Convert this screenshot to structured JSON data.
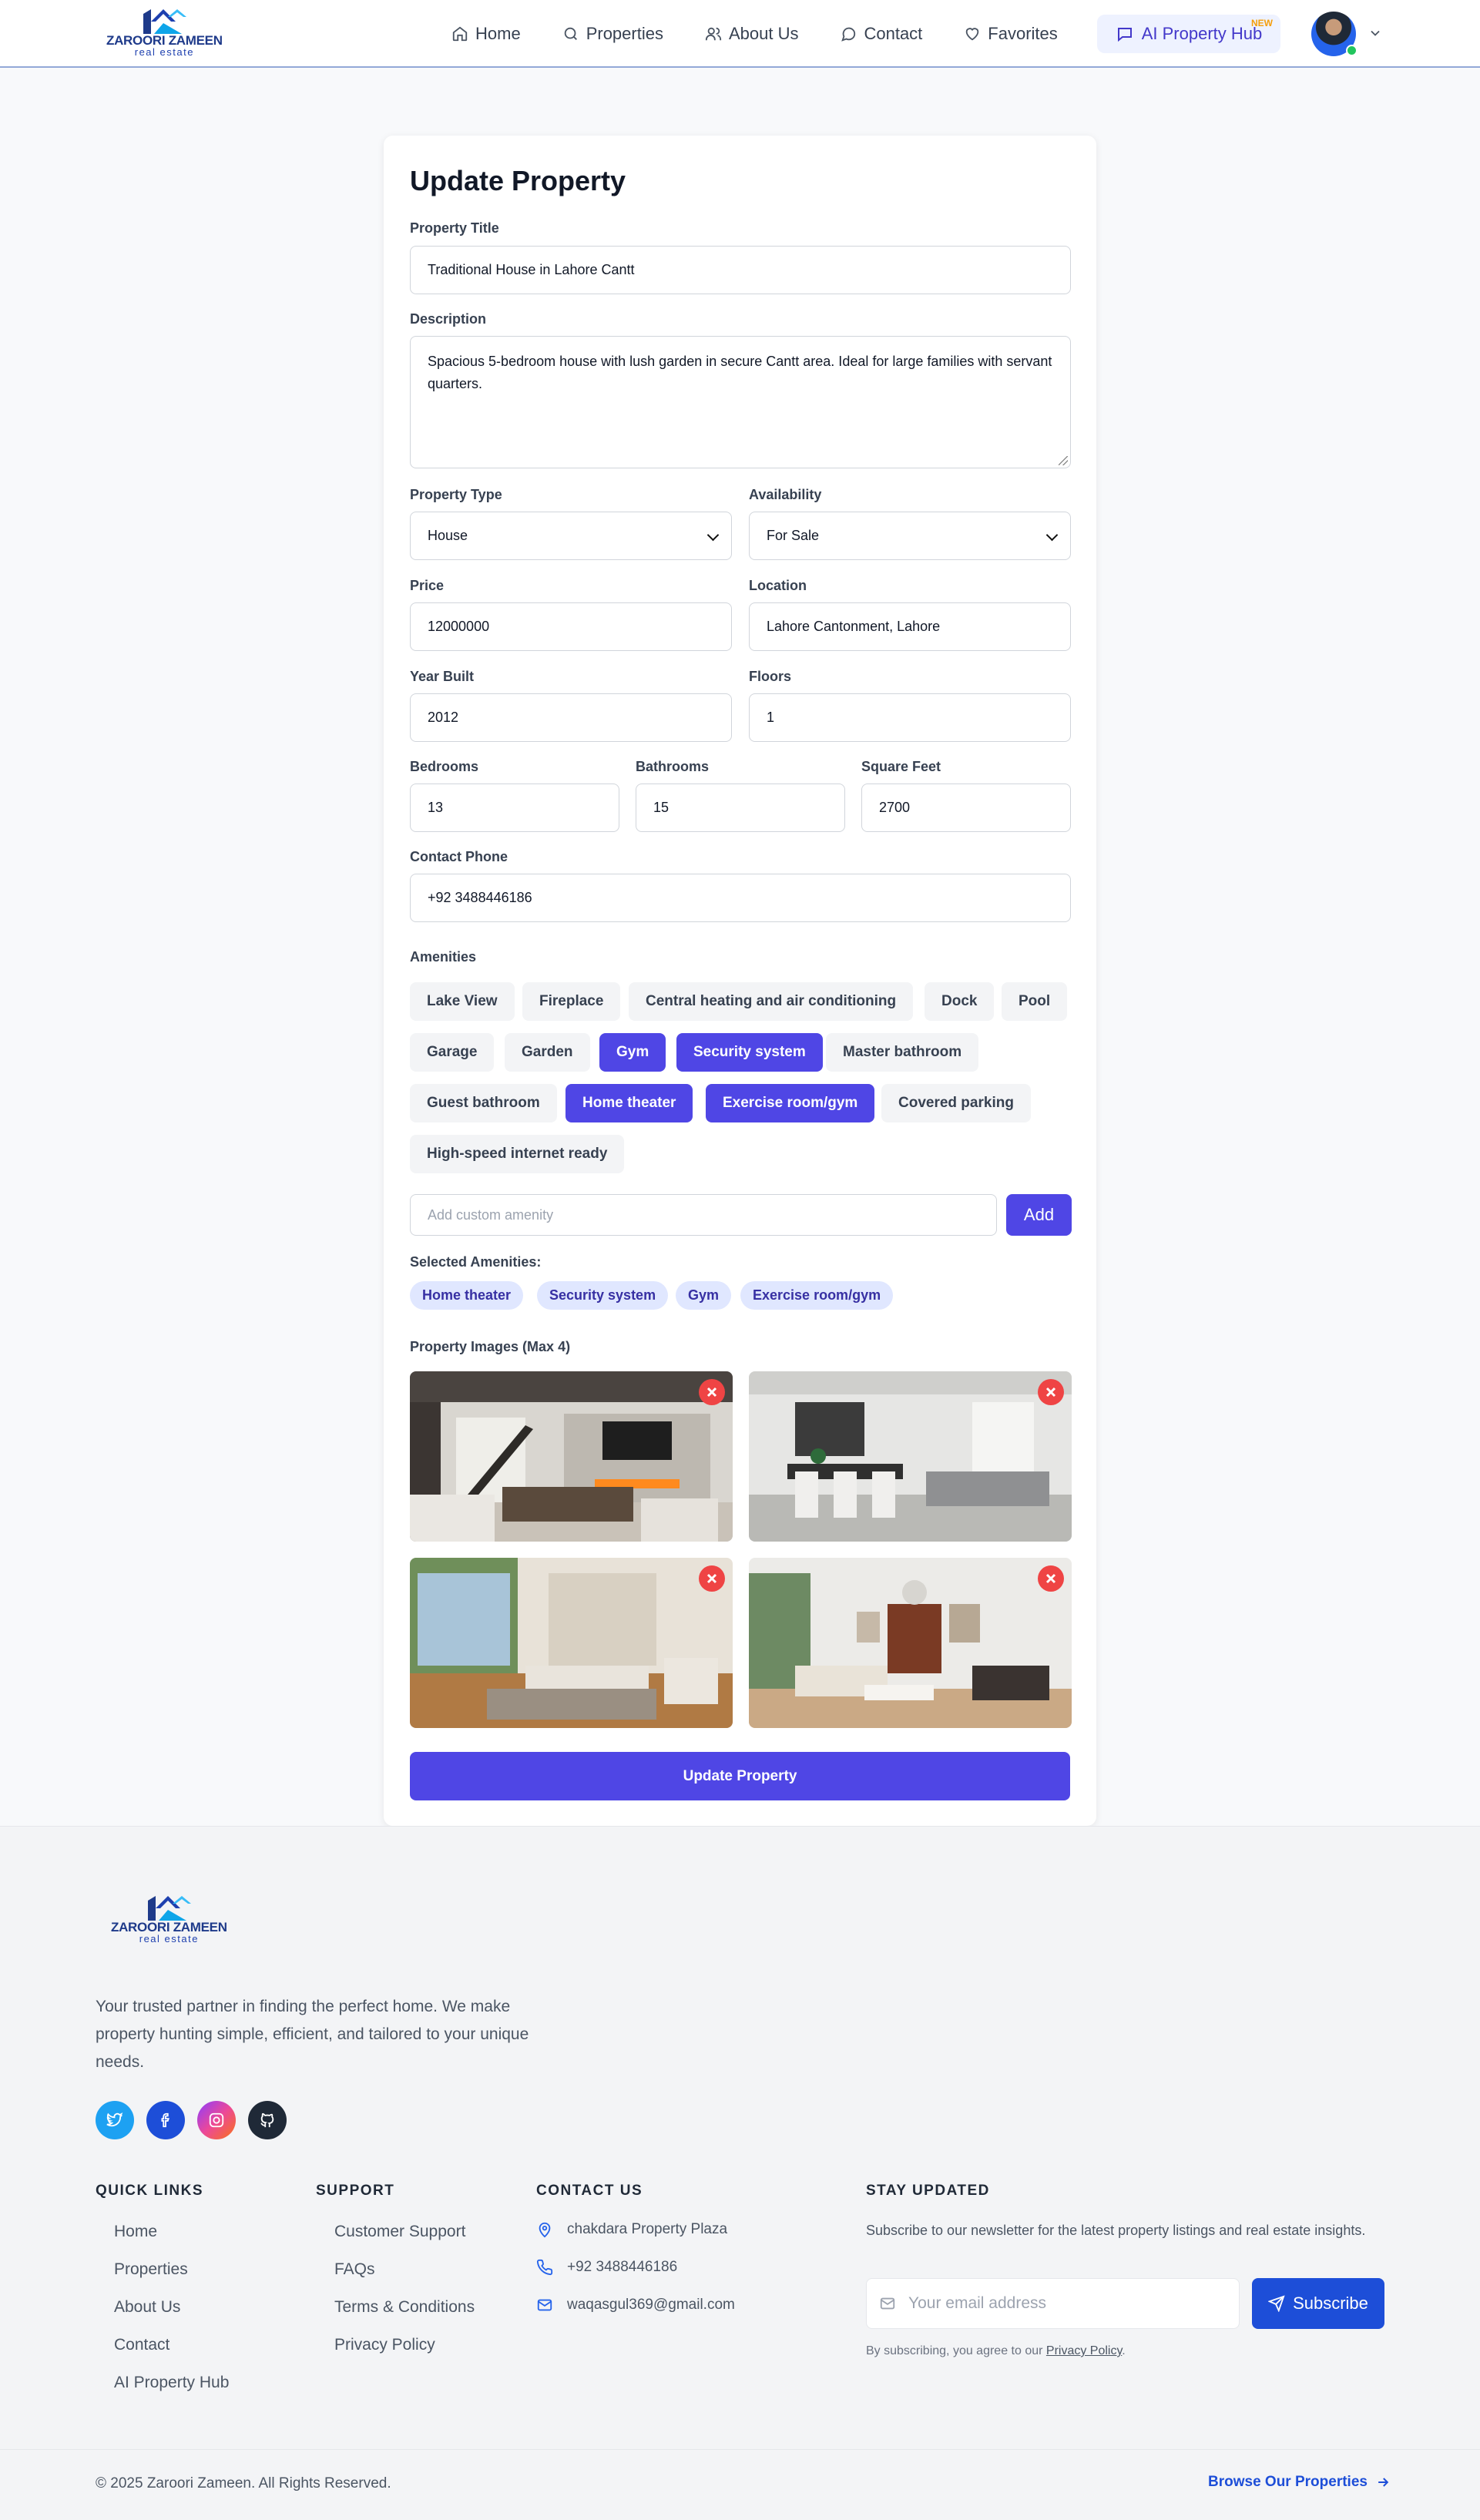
{
  "brand": {
    "name": "ZAROORI ZAMEEN",
    "tagline": "real estate"
  },
  "nav": {
    "items": [
      {
        "label": "Home",
        "icon": "home-icon"
      },
      {
        "label": "Properties",
        "icon": "search-icon"
      },
      {
        "label": "About Us",
        "icon": "users-icon"
      },
      {
        "label": "Contact",
        "icon": "message-circle-icon"
      },
      {
        "label": "Favorites",
        "icon": "heart-icon"
      }
    ],
    "ai_hub": {
      "label": "AI Property Hub",
      "badge": "NEW",
      "icon": "chat-bot-icon"
    }
  },
  "form": {
    "title": "Update Property",
    "title_label": "Property Title",
    "title_value": "Traditional House in Lahore Cantt",
    "description_label": "Description",
    "description_value": "Spacious 5-bedroom house with lush garden in secure Cantt area. Ideal for large families with servant quarters.",
    "type_label": "Property Type",
    "type_value": "House",
    "availability_label": "Availability",
    "availability_value": "For Sale",
    "price_label": "Price",
    "price_value": "12000000",
    "location_label": "Location",
    "location_value": "Lahore Cantonment, Lahore",
    "year_label": "Year Built",
    "year_value": "2012",
    "floors_label": "Floors",
    "floors_value": "1",
    "bedrooms_label": "Bedrooms",
    "bedrooms_value": "13",
    "bathrooms_label": "Bathrooms",
    "bathrooms_value": "15",
    "sqft_label": "Square Feet",
    "sqft_value": "2700",
    "phone_label": "Contact Phone",
    "phone_value": "+92 3488446186",
    "amenities_label": "Amenities",
    "amenities": [
      {
        "label": "Lake View",
        "selected": false
      },
      {
        "label": "Fireplace",
        "selected": false
      },
      {
        "label": "Central heating and air conditioning",
        "selected": false
      },
      {
        "label": "Dock",
        "selected": false
      },
      {
        "label": "Pool",
        "selected": false
      },
      {
        "label": "Garage",
        "selected": false
      },
      {
        "label": "Garden",
        "selected": false
      },
      {
        "label": "Gym",
        "selected": true
      },
      {
        "label": "Security system",
        "selected": true
      },
      {
        "label": "Master bathroom",
        "selected": false
      },
      {
        "label": "Guest bathroom",
        "selected": false
      },
      {
        "label": "Home theater",
        "selected": true
      },
      {
        "label": "Exercise room/gym",
        "selected": true
      },
      {
        "label": "Covered parking",
        "selected": false
      },
      {
        "label": "High-speed internet ready",
        "selected": false
      }
    ],
    "custom_amenity_placeholder": "Add custom amenity",
    "add_label": "Add",
    "selected_label": "Selected Amenities:",
    "selected_amenities": [
      "Home theater",
      "Security system",
      "Gym",
      "Exercise room/gym"
    ],
    "images_label": "Property Images (Max 4)",
    "submit_label": "Update Property"
  },
  "footer": {
    "description": "Your trusted partner in finding the perfect home. We make property hunting simple, efficient, and tailored to your unique needs.",
    "social": [
      "twitter-icon",
      "facebook-icon",
      "instagram-icon",
      "github-icon"
    ],
    "quick_links_heading": "QUICK LINKS",
    "quick_links": [
      "Home",
      "Properties",
      "About Us",
      "Contact",
      "AI Property Hub"
    ],
    "support_heading": "SUPPORT",
    "support_links": [
      "Customer Support",
      "FAQs",
      "Terms & Conditions",
      "Privacy Policy"
    ],
    "contact_heading": "CONTACT US",
    "contact": {
      "address": "chakdara Property Plaza",
      "phone": "+92 3488446186",
      "email": "waqasgul369@gmail.com"
    },
    "newsletter_heading": "STAY UPDATED",
    "newsletter_text": "Subscribe to our newsletter for the latest property listings and real estate insights.",
    "email_placeholder": "Your email address",
    "subscribe_label": "Subscribe",
    "agree_prefix": "By subscribing, you agree to our ",
    "agree_link": "Privacy Policy",
    "agree_suffix": ".",
    "copyright": "© 2025 Zaroori Zameen. All Rights Reserved.",
    "browse_label": "Browse Our Properties"
  },
  "colors": {
    "accent": "#4f46e5",
    "brand_blue": "#1d4ed8",
    "remove_red": "#ef4444"
  }
}
